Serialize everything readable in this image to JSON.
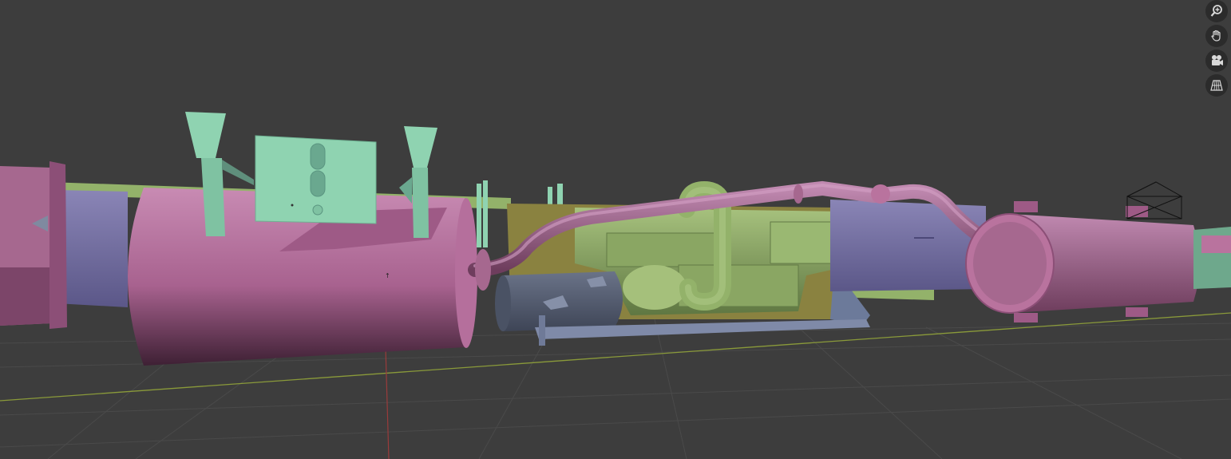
{
  "viewport": {
    "mode": "3D Viewport",
    "shading": "solid",
    "objects": [
      "flange",
      "silencer-tank",
      "control-panel",
      "mount-bracket-left",
      "mount-bracket-right",
      "battery",
      "engine-block",
      "exhaust-pipe",
      "muffler",
      "skid-frame",
      "light-object"
    ],
    "colors": {
      "background": "#3d3d3d",
      "grid": "#4a4a4a",
      "x_axis": "#8a9a3a",
      "y_axis": "#9a3b3b",
      "pink": "#b9739e",
      "mint": "#8fd3b1",
      "green": "#93b26a",
      "violet": "#7c77a8",
      "slate": "#576072",
      "olive": "#8a8240"
    }
  },
  "navigation_gizmo": {
    "buttons": [
      {
        "name": "zoom-icon",
        "tooltip": ""
      },
      {
        "name": "hand-pan-icon",
        "tooltip": ""
      },
      {
        "name": "camera-icon",
        "tooltip": ""
      },
      {
        "name": "grid-perspective-icon",
        "tooltip": ""
      }
    ]
  }
}
